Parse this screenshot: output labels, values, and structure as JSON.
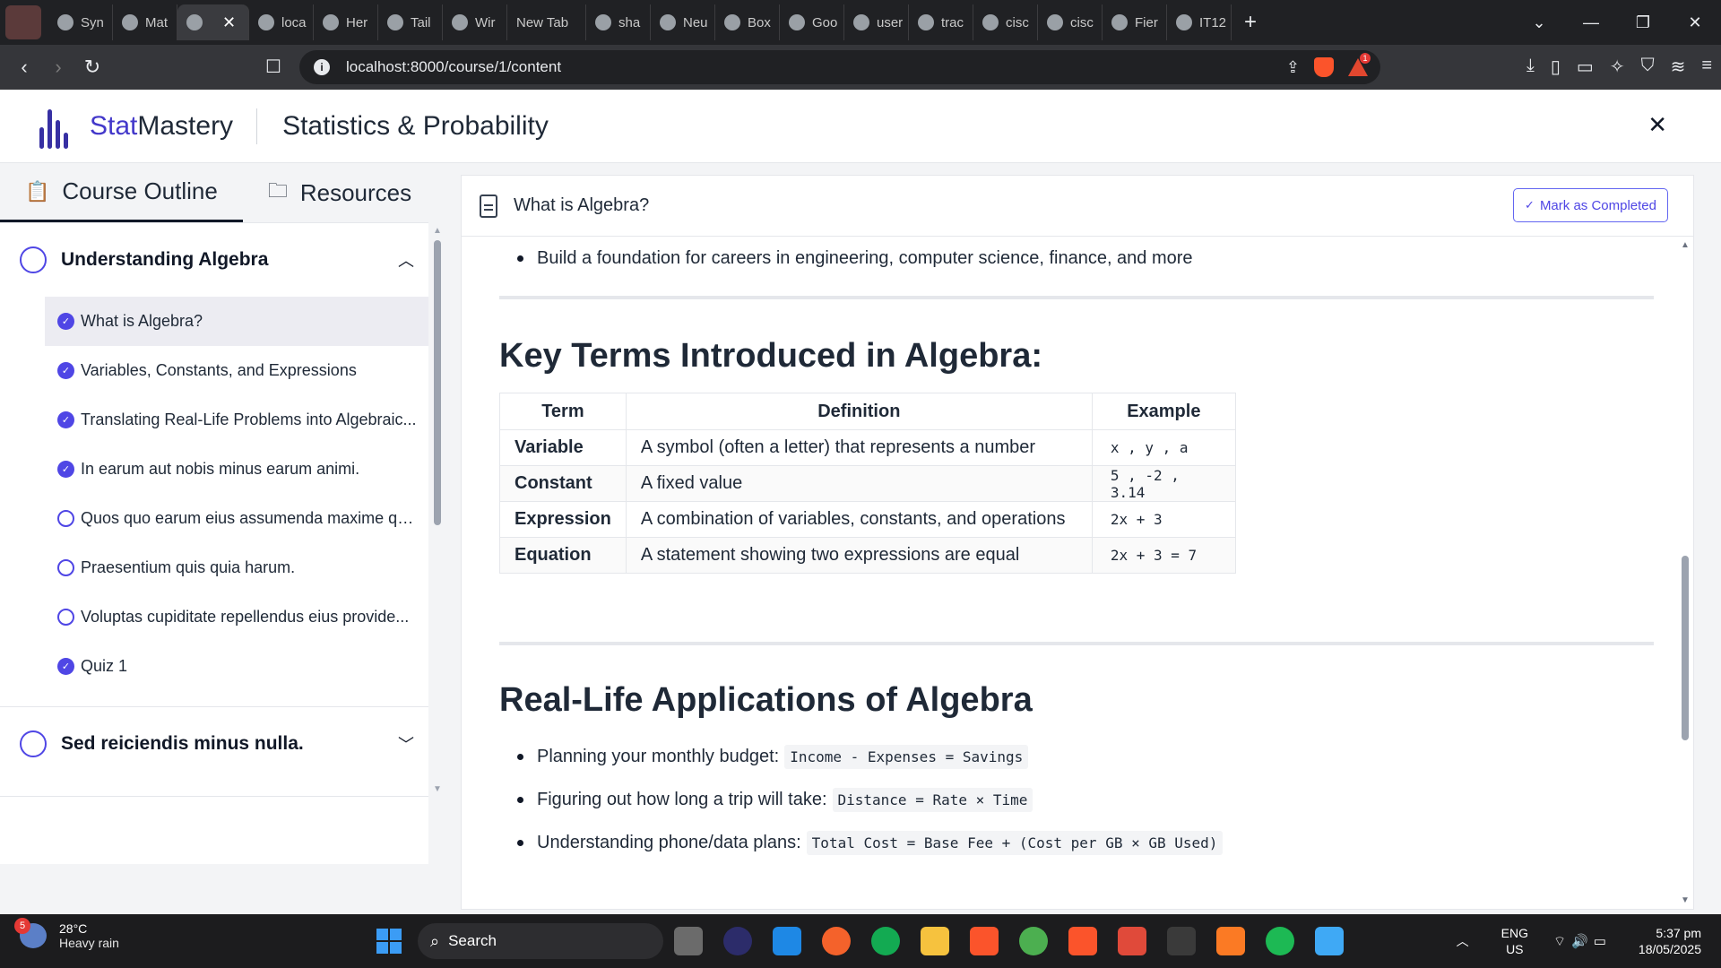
{
  "browser": {
    "tabs": [
      {
        "label": "Syn",
        "icon": "openai-icon"
      },
      {
        "label": "Mat",
        "icon": "openai-icon"
      },
      {
        "label": "",
        "icon": "laravel-icon",
        "active": true
      },
      {
        "label": "loca",
        "icon": "xampp-icon"
      },
      {
        "label": "Her",
        "icon": "shield-icon"
      },
      {
        "label": "Tail",
        "icon": "smiley-icon"
      },
      {
        "label": "Wir",
        "icon": "globe-icon"
      },
      {
        "label": "New Tab",
        "icon": ""
      },
      {
        "label": "sha",
        "icon": "google-icon"
      },
      {
        "label": "Neu",
        "icon": "openai-icon"
      },
      {
        "label": "Box",
        "icon": "box-icon"
      },
      {
        "label": "Goo",
        "icon": "calendar-icon"
      },
      {
        "label": "user",
        "icon": "google-icon"
      },
      {
        "label": "trac",
        "icon": "google-icon"
      },
      {
        "label": "cisc",
        "icon": "google-icon"
      },
      {
        "label": "cisc",
        "icon": "google-icon"
      },
      {
        "label": "Fier",
        "icon": "github-icon"
      },
      {
        "label": "IT12",
        "icon": "docs-icon"
      }
    ],
    "url": "localhost:8000/course/1/content",
    "notification_count": "1"
  },
  "app": {
    "brand_part1": "Stat",
    "brand_part2": "Mastery",
    "course_title": "Statistics & Probability"
  },
  "sidebar": {
    "tab_outline": "Course Outline",
    "tab_resources": "Resources",
    "sections": [
      {
        "title": "Understanding Algebra",
        "expanded": true,
        "lessons": [
          {
            "label": "What is Algebra?",
            "done": true,
            "selected": true
          },
          {
            "label": "Variables, Constants, and Expressions",
            "done": true
          },
          {
            "label": "Translating Real-Life Problems into Algebraic...",
            "done": true
          },
          {
            "label": "In earum aut nobis minus earum animi.",
            "done": true
          },
          {
            "label": "Quos quo earum eius assumenda maxime qui...",
            "done": false
          },
          {
            "label": "Praesentium quis quia harum.",
            "done": false
          },
          {
            "label": "Voluptas cupiditate repellendus eius provide...",
            "done": false
          },
          {
            "label": "Quiz 1",
            "done": true
          }
        ]
      },
      {
        "title": "Sed reiciendis minus nulla.",
        "expanded": false
      }
    ]
  },
  "content": {
    "lesson_title": "What is Algebra?",
    "mark_completed": "Mark as Completed",
    "top_bullet": "Build a foundation for careers in engineering, computer science, finance, and more",
    "key_terms_heading": "Key Terms Introduced in Algebra:",
    "table": {
      "headers": [
        "Term",
        "Definition",
        "Example"
      ],
      "rows": [
        {
          "term": "Variable",
          "definition": "A symbol (often a letter) that represents a number",
          "example": "x , y , a"
        },
        {
          "term": "Constant",
          "definition": "A fixed value",
          "example": "5 , -2 , 3.14"
        },
        {
          "term": "Expression",
          "definition": "A combination of variables, constants, and operations",
          "example": "2x + 3"
        },
        {
          "term": "Equation",
          "definition": "A statement showing two expressions are equal",
          "example": "2x + 3 = 7"
        }
      ]
    },
    "applications_heading": "Real-Life Applications of Algebra",
    "applications": [
      {
        "text": "Planning your monthly budget:",
        "code": "Income - Expenses = Savings"
      },
      {
        "text": "Figuring out how long a trip will take:",
        "code": "Distance = Rate × Time"
      },
      {
        "text": "Understanding phone/data plans:",
        "code": "Total Cost = Base Fee + (Cost per GB × GB Used)"
      }
    ]
  },
  "taskbar": {
    "weather_temp": "28°C",
    "weather_desc": "Heavy rain",
    "weather_badge": "5",
    "search_placeholder": "Search",
    "lang_line1": "ENG",
    "lang_line2": "US",
    "time": "5:37 pm",
    "date": "18/05/2025"
  },
  "colors": {
    "accent": "#4f46e5",
    "brand": "#4338ca"
  }
}
